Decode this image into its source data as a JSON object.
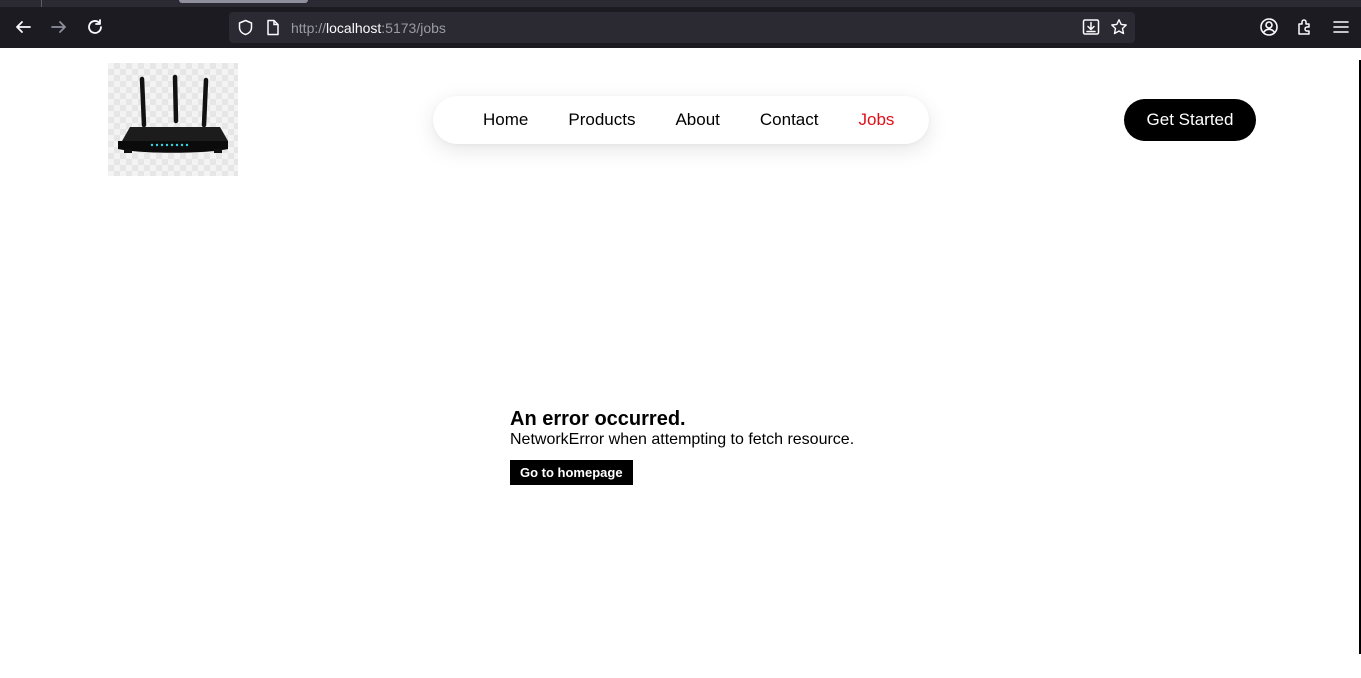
{
  "browser": {
    "url_scheme": "http://",
    "url_host": "localhost",
    "url_rest": ":5173/jobs"
  },
  "site": {
    "nav": {
      "items": [
        {
          "label": "Home"
        },
        {
          "label": "Products"
        },
        {
          "label": "About"
        },
        {
          "label": "Contact"
        },
        {
          "label": "Jobs",
          "active": true
        }
      ]
    },
    "cta_label": "Get Started",
    "accent_color": "#e0101a"
  },
  "error": {
    "title": "An error occurred.",
    "message": "NetworkError when attempting to fetch resource.",
    "button_label": "Go to homepage"
  }
}
